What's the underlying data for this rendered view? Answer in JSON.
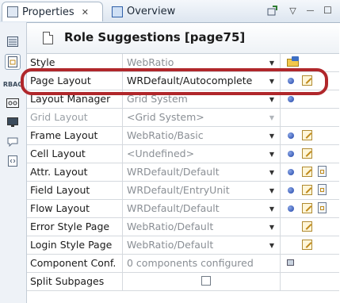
{
  "tabs": [
    {
      "label": "Properties",
      "icon": "properties-icon",
      "active": true
    },
    {
      "label": "Overview",
      "icon": "overview-icon",
      "active": false
    }
  ],
  "tab_close_glyph": "✕",
  "toolbar": {
    "icons": [
      "pin-icon",
      "view-menu-icon",
      "minimize-icon",
      "maximize-icon"
    ],
    "view_menu_glyph": "▽",
    "minimize_glyph": "—",
    "maximize_glyph": "☐"
  },
  "sidebar": {
    "icons": [
      "properties-tab-icon",
      "layout-tab-icon",
      "roles-tab-icon",
      "access-tab-icon",
      "display-tab-icon",
      "comment-tab-icon",
      "custom-tab-icon"
    ],
    "selected": "layout-tab-icon",
    "roles_tab_label": "RBAC"
  },
  "header": {
    "title": "Role Suggestions [page75]",
    "icon": "page-icon"
  },
  "dropdown_glyph": "▼",
  "rows": [
    {
      "name": "Style",
      "value": "WebRatio",
      "dropdown": true,
      "actions": [
        "style-folder-icon"
      ]
    },
    {
      "name": "Page Layout",
      "value": "WRDefault/Autocomplete",
      "dropdown": true,
      "active": true,
      "actions": [
        "info-dot-icon",
        "edit-icon"
      ]
    },
    {
      "name": "Layout Manager",
      "value": "Grid System",
      "dropdown": true,
      "actions": [
        "info-dot-icon"
      ]
    },
    {
      "name": "Grid Layout",
      "value": "<Grid System>",
      "dropdown": true,
      "disabled": true,
      "actions": []
    },
    {
      "name": "Frame Layout",
      "value": "WebRatio/Basic",
      "dropdown": true,
      "actions": [
        "info-dot-icon",
        "edit-icon"
      ]
    },
    {
      "name": "Cell Layout",
      "value": "<Undefined>",
      "dropdown": true,
      "actions": [
        "info-dot-icon",
        "edit-icon"
      ]
    },
    {
      "name": "Attr. Layout",
      "value": "WRDefault/Default",
      "dropdown": true,
      "actions": [
        "info-dot-icon",
        "edit-icon",
        "template-icon"
      ]
    },
    {
      "name": "Field Layout",
      "value": "WRDefault/EntryUnit",
      "dropdown": true,
      "actions": [
        "info-dot-icon",
        "edit-icon",
        "template-icon"
      ]
    },
    {
      "name": "Flow Layout",
      "value": "WRDefault/Default",
      "dropdown": true,
      "actions": [
        "info-dot-icon",
        "edit-icon",
        "template-icon"
      ]
    },
    {
      "name": "Error Style Page",
      "value": "WebRatio/Default",
      "dropdown": true,
      "actions": [
        "edit-icon"
      ]
    },
    {
      "name": "Login Style Page",
      "value": "WebRatio/Default",
      "dropdown": true,
      "actions": [
        "edit-icon"
      ]
    },
    {
      "name": "Component Conf.",
      "value": "0 components configured",
      "dropdown": false,
      "actions": [
        "configure-icon"
      ]
    },
    {
      "name": "Split Subpages",
      "value": "",
      "checkbox": true,
      "checked": false,
      "actions": []
    }
  ],
  "colors": {
    "accent": "#b0272b",
    "link_blue": "#1f43a8",
    "header_text": "#1a1a1a"
  }
}
